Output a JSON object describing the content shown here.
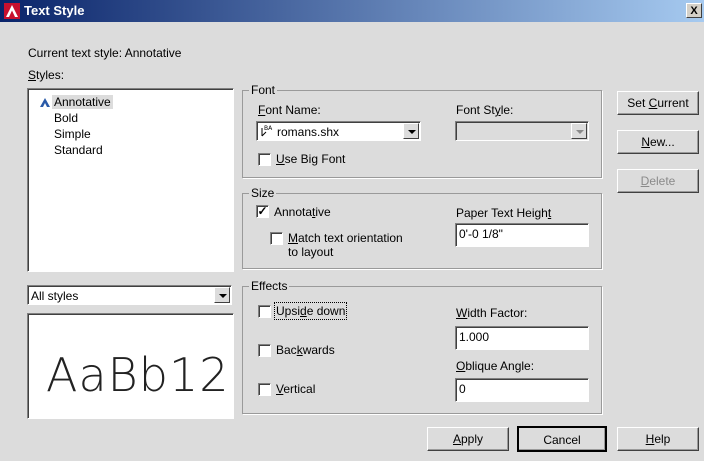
{
  "window": {
    "title": "Text Style",
    "close_label": "X",
    "accent": "#0a246a"
  },
  "current_style": {
    "label": "Current text style:",
    "value": "Annotative"
  },
  "styles": {
    "label_pre": "",
    "label_ul": "S",
    "label_post": "tyles:",
    "items": [
      "Annotative",
      "Bold",
      "Simple",
      "Standard"
    ],
    "selected_index": 0
  },
  "filter": {
    "value": "All styles"
  },
  "preview": {
    "text": "AaBb12"
  },
  "font": {
    "group_label": "Font",
    "name_label_ul": "F",
    "name_label_post": "ont Name:",
    "name_value": "romans.shx",
    "style_label_pre": "Font St",
    "style_label_ul": "y",
    "style_label_post": "le:",
    "style_value": "",
    "bigfont_ul": "U",
    "bigfont_post": "se Big Font",
    "bigfont_checked": false
  },
  "size": {
    "group_label": "Size",
    "annotative_label_pre": "Annota",
    "annotative_label_ul": "t",
    "annotative_label_post": "ive",
    "annotative_checked": true,
    "match_label_ul": "M",
    "match_label_line1_post": "atch text orientation",
    "match_label_line2": "to layout",
    "match_checked": false,
    "height_label_pre": "Paper Text Heigh",
    "height_label_ul": "t",
    "height_label_post": "",
    "height_value": "0'-0 1/8\""
  },
  "effects": {
    "group_label": "Effects",
    "upside_pre": "Upsi",
    "upside_ul": "d",
    "upside_post": "e down",
    "upside_checked": false,
    "backwards_pre": "Bac",
    "backwards_ul": "k",
    "backwards_post": "wards",
    "backwards_checked": false,
    "vertical_ul": "V",
    "vertical_post": "ertical",
    "vertical_checked": false,
    "width_ul": "W",
    "width_post": "idth Factor:",
    "width_value": "1.000",
    "oblique_ul": "O",
    "oblique_post": "blique Angle:",
    "oblique_value": "0"
  },
  "buttons": {
    "set_current_pre": "Set ",
    "set_current_ul": "C",
    "set_current_post": "urrent",
    "new_ul": "N",
    "new_post": "ew...",
    "delete_ul": "D",
    "delete_post": "elete",
    "apply_ul": "A",
    "apply_post": "pply",
    "cancel": "Cancel",
    "help_ul": "H",
    "help_post": "elp"
  }
}
